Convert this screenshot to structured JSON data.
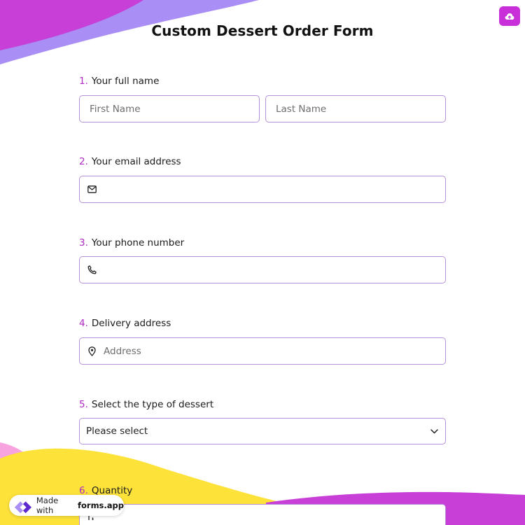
{
  "form": {
    "title": "Custom Dessert Order Form"
  },
  "questions": [
    {
      "number": "1.",
      "label": "Your full name",
      "first_placeholder": "First Name",
      "last_placeholder": "Last Name"
    },
    {
      "number": "2.",
      "label": "Your email address",
      "icon": "mail-icon"
    },
    {
      "number": "3.",
      "label": "Your phone number",
      "icon": "phone-icon"
    },
    {
      "number": "4.",
      "label": "Delivery address",
      "icon": "location-pin-icon",
      "placeholder": "Address"
    },
    {
      "number": "5.",
      "label": "Select the type of dessert",
      "selected": "Please select",
      "icon": "chevron-down-icon"
    },
    {
      "number": "6.",
      "label": "Quantity",
      "icon": "sort-numeric-icon"
    }
  ],
  "badge": {
    "made_with": "Made with",
    "brand": "forms.app"
  },
  "colors": {
    "accent": "#c92fd8",
    "number": "#b02ac5",
    "border": "#b591d9",
    "shape_magenta": "#c73fd6",
    "shape_lavender": "#a98ef5",
    "shape_yellow": "#fde23a",
    "shape_pink": "#f6a3df"
  }
}
